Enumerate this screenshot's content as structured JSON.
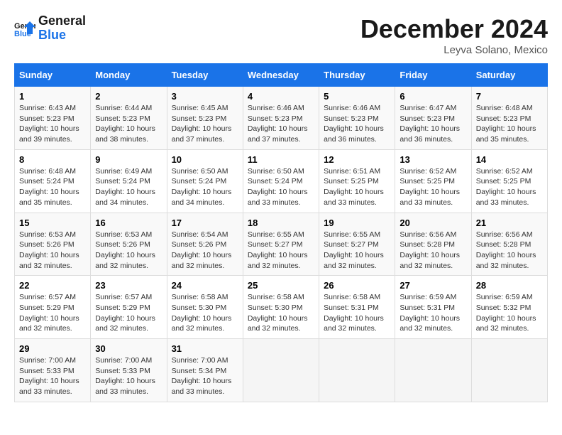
{
  "logo": {
    "line1": "General",
    "line2": "Blue"
  },
  "title": "December 2024",
  "subtitle": "Leyva Solano, Mexico",
  "days_of_week": [
    "Sunday",
    "Monday",
    "Tuesday",
    "Wednesday",
    "Thursday",
    "Friday",
    "Saturday"
  ],
  "weeks": [
    [
      {
        "day": 1,
        "info": "Sunrise: 6:43 AM\nSunset: 5:23 PM\nDaylight: 10 hours\nand 39 minutes."
      },
      {
        "day": 2,
        "info": "Sunrise: 6:44 AM\nSunset: 5:23 PM\nDaylight: 10 hours\nand 38 minutes."
      },
      {
        "day": 3,
        "info": "Sunrise: 6:45 AM\nSunset: 5:23 PM\nDaylight: 10 hours\nand 37 minutes."
      },
      {
        "day": 4,
        "info": "Sunrise: 6:46 AM\nSunset: 5:23 PM\nDaylight: 10 hours\nand 37 minutes."
      },
      {
        "day": 5,
        "info": "Sunrise: 6:46 AM\nSunset: 5:23 PM\nDaylight: 10 hours\nand 36 minutes."
      },
      {
        "day": 6,
        "info": "Sunrise: 6:47 AM\nSunset: 5:23 PM\nDaylight: 10 hours\nand 36 minutes."
      },
      {
        "day": 7,
        "info": "Sunrise: 6:48 AM\nSunset: 5:23 PM\nDaylight: 10 hours\nand 35 minutes."
      }
    ],
    [
      {
        "day": 8,
        "info": "Sunrise: 6:48 AM\nSunset: 5:24 PM\nDaylight: 10 hours\nand 35 minutes."
      },
      {
        "day": 9,
        "info": "Sunrise: 6:49 AM\nSunset: 5:24 PM\nDaylight: 10 hours\nand 34 minutes."
      },
      {
        "day": 10,
        "info": "Sunrise: 6:50 AM\nSunset: 5:24 PM\nDaylight: 10 hours\nand 34 minutes."
      },
      {
        "day": 11,
        "info": "Sunrise: 6:50 AM\nSunset: 5:24 PM\nDaylight: 10 hours\nand 33 minutes."
      },
      {
        "day": 12,
        "info": "Sunrise: 6:51 AM\nSunset: 5:25 PM\nDaylight: 10 hours\nand 33 minutes."
      },
      {
        "day": 13,
        "info": "Sunrise: 6:52 AM\nSunset: 5:25 PM\nDaylight: 10 hours\nand 33 minutes."
      },
      {
        "day": 14,
        "info": "Sunrise: 6:52 AM\nSunset: 5:25 PM\nDaylight: 10 hours\nand 33 minutes."
      }
    ],
    [
      {
        "day": 15,
        "info": "Sunrise: 6:53 AM\nSunset: 5:26 PM\nDaylight: 10 hours\nand 32 minutes."
      },
      {
        "day": 16,
        "info": "Sunrise: 6:53 AM\nSunset: 5:26 PM\nDaylight: 10 hours\nand 32 minutes."
      },
      {
        "day": 17,
        "info": "Sunrise: 6:54 AM\nSunset: 5:26 PM\nDaylight: 10 hours\nand 32 minutes."
      },
      {
        "day": 18,
        "info": "Sunrise: 6:55 AM\nSunset: 5:27 PM\nDaylight: 10 hours\nand 32 minutes."
      },
      {
        "day": 19,
        "info": "Sunrise: 6:55 AM\nSunset: 5:27 PM\nDaylight: 10 hours\nand 32 minutes."
      },
      {
        "day": 20,
        "info": "Sunrise: 6:56 AM\nSunset: 5:28 PM\nDaylight: 10 hours\nand 32 minutes."
      },
      {
        "day": 21,
        "info": "Sunrise: 6:56 AM\nSunset: 5:28 PM\nDaylight: 10 hours\nand 32 minutes."
      }
    ],
    [
      {
        "day": 22,
        "info": "Sunrise: 6:57 AM\nSunset: 5:29 PM\nDaylight: 10 hours\nand 32 minutes."
      },
      {
        "day": 23,
        "info": "Sunrise: 6:57 AM\nSunset: 5:29 PM\nDaylight: 10 hours\nand 32 minutes."
      },
      {
        "day": 24,
        "info": "Sunrise: 6:58 AM\nSunset: 5:30 PM\nDaylight: 10 hours\nand 32 minutes."
      },
      {
        "day": 25,
        "info": "Sunrise: 6:58 AM\nSunset: 5:30 PM\nDaylight: 10 hours\nand 32 minutes."
      },
      {
        "day": 26,
        "info": "Sunrise: 6:58 AM\nSunset: 5:31 PM\nDaylight: 10 hours\nand 32 minutes."
      },
      {
        "day": 27,
        "info": "Sunrise: 6:59 AM\nSunset: 5:31 PM\nDaylight: 10 hours\nand 32 minutes."
      },
      {
        "day": 28,
        "info": "Sunrise: 6:59 AM\nSunset: 5:32 PM\nDaylight: 10 hours\nand 32 minutes."
      }
    ],
    [
      {
        "day": 29,
        "info": "Sunrise: 7:00 AM\nSunset: 5:33 PM\nDaylight: 10 hours\nand 33 minutes."
      },
      {
        "day": 30,
        "info": "Sunrise: 7:00 AM\nSunset: 5:33 PM\nDaylight: 10 hours\nand 33 minutes."
      },
      {
        "day": 31,
        "info": "Sunrise: 7:00 AM\nSunset: 5:34 PM\nDaylight: 10 hours\nand 33 minutes."
      },
      null,
      null,
      null,
      null
    ]
  ]
}
